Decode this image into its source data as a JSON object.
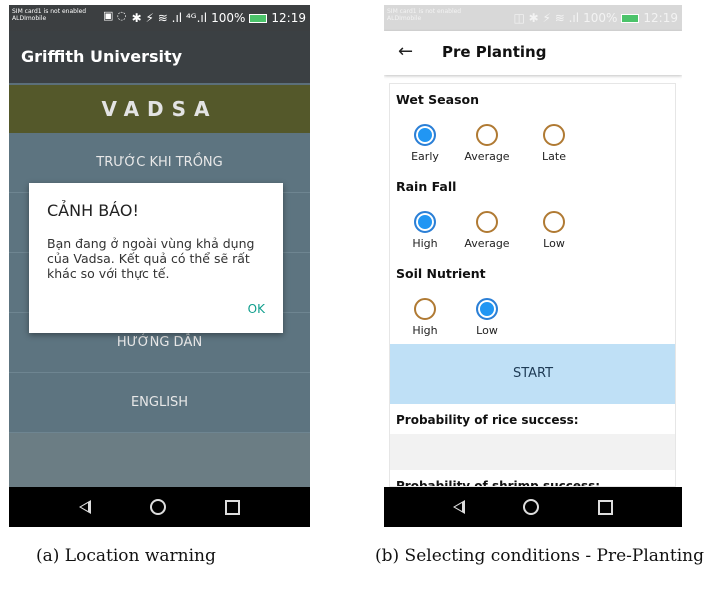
{
  "phone_a": {
    "status": {
      "sim_line1": "SIM card1 is not enabled",
      "sim_line2": "ALDImobile",
      "indicators": "✱ ⚡ ≋ .ıl ⁴ᴳ.ıl",
      "battery": "100%",
      "time": "12:19"
    },
    "appbar_title": "Griffith University",
    "banner": "VADSA",
    "menu": [
      "TRƯỚC KHI TRỒNG",
      "",
      "",
      "HƯỚNG DẪN",
      "ENGLISH"
    ],
    "dialog": {
      "title": "CẢNH BÁO!",
      "message": "Bạn đang ở ngoài vùng khả dụng của Vadsa. Kết quả có thể sẽ rất khác so với thực tế.",
      "ok": "OK"
    }
  },
  "phone_b": {
    "status": {
      "sim_line1": "SIM card1 is not enabled",
      "sim_line2": "ALDImobile",
      "indicators": "◫ ✱ ⚡ ≋ .ıl",
      "battery": "100%",
      "time": "12:19"
    },
    "title": "Pre Planting",
    "sections": [
      {
        "label": "Wet Season",
        "options": [
          {
            "label": "Early",
            "selected": true
          },
          {
            "label": "Average",
            "selected": false
          },
          {
            "label": "Late",
            "selected": false
          }
        ]
      },
      {
        "label": "Rain Fall",
        "options": [
          {
            "label": "High",
            "selected": true
          },
          {
            "label": "Average",
            "selected": false
          },
          {
            "label": "Low",
            "selected": false
          }
        ]
      },
      {
        "label": "Soil Nutrient",
        "options": [
          {
            "label": "High",
            "selected": false
          },
          {
            "label": "Low",
            "selected": true
          }
        ]
      }
    ],
    "start": "START",
    "prob_rice": "Probability of rice success:",
    "prob_shrimp": "Probability of shrimp success:"
  },
  "captions": {
    "a": "(a) Location warning",
    "b": "(b) Selecting conditions - Pre-Planting"
  },
  "colors": {
    "radio_selected": "#2196f3",
    "radio_unselected": "#b07a33",
    "start_button": "#bfe0f6",
    "dialog_ok": "#119f8e"
  }
}
